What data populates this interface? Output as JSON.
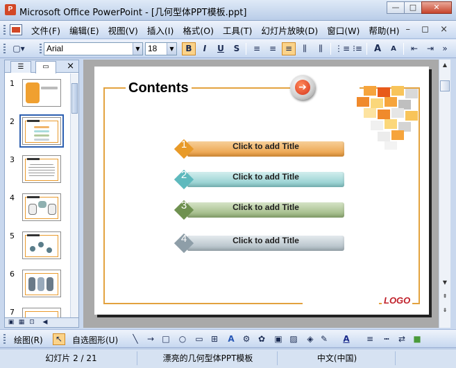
{
  "window": {
    "title": "Microsoft Office PowerPoint - [几何型体PPT模板.ppt]",
    "app_icon": "P",
    "buttons": {
      "minimize": "—",
      "maximize": "□",
      "close": "✕"
    }
  },
  "menubar": {
    "items": [
      {
        "label": "文件(F)"
      },
      {
        "label": "编辑(E)"
      },
      {
        "label": "视图(V)"
      },
      {
        "label": "插入(I)"
      },
      {
        "label": "格式(O)"
      },
      {
        "label": "工具(T)"
      },
      {
        "label": "幻灯片放映(D)"
      },
      {
        "label": "窗口(W)"
      },
      {
        "label": "帮助(H)"
      }
    ],
    "doc_controls": "– ◻ ×"
  },
  "toolbar": {
    "font_name": "Arial",
    "font_size": "18",
    "bold": "B",
    "italic": "I",
    "underline": "U",
    "shadow": "S",
    "align_left": "≡",
    "align_center": "≡",
    "align_right": "≡",
    "distribute": "⫼",
    "numbering": "⋮≡",
    "bullets": "⁝≡",
    "increase_font": "A",
    "decrease_font": "A",
    "decrease_indent": "⇤",
    "increase_indent": "⇥",
    "more": "»"
  },
  "outline_pane": {
    "tab_outline": "☰",
    "tab_slides": "▭",
    "close": "×",
    "slides": [
      {
        "number": "1"
      },
      {
        "number": "2",
        "selected": true
      },
      {
        "number": "3"
      },
      {
        "number": "4"
      },
      {
        "number": "5"
      },
      {
        "number": "6"
      },
      {
        "number": "7"
      }
    ],
    "view_buttons": [
      "▣",
      "▦",
      "⊡"
    ]
  },
  "slide": {
    "title": "Contents",
    "arrow_glyph": "➔",
    "items": [
      {
        "number": "1",
        "label": "Click to add Title",
        "diamond_color": "#e89a28",
        "bar_color": "#f0b46a"
      },
      {
        "number": "2",
        "label": "Click to add Title",
        "diamond_color": "#5eb9bd",
        "bar_color": "#a9dcdc"
      },
      {
        "number": "3",
        "label": "Click to add Title",
        "diamond_color": "#6f9150",
        "bar_color": "#b3c99d"
      },
      {
        "number": "4",
        "label": "Click to add Title",
        "diamond_color": "#8e9ea8",
        "bar_color": "#c7d2d8"
      }
    ],
    "logo": "LOGO"
  },
  "scrollbar": {
    "up": "▲",
    "down": "▼",
    "prev_slide": "⇞",
    "next_slide": "⇟"
  },
  "drawbar": {
    "draw_label": "绘图(R)",
    "autoshapes_label": "自选图形(U)",
    "tools": [
      "↖",
      "╲",
      "→",
      "□",
      "○",
      "▭",
      "⊞",
      "A",
      "⚙",
      "✿",
      "▣",
      "▨",
      "◈",
      "✎",
      "A",
      "≡",
      "┅",
      "⇄",
      "■"
    ]
  },
  "statusbar": {
    "slide_indicator": "幻灯片 2 / 21",
    "design_name": "漂亮的几何型体PPT模板",
    "language": "中文(中国)"
  }
}
